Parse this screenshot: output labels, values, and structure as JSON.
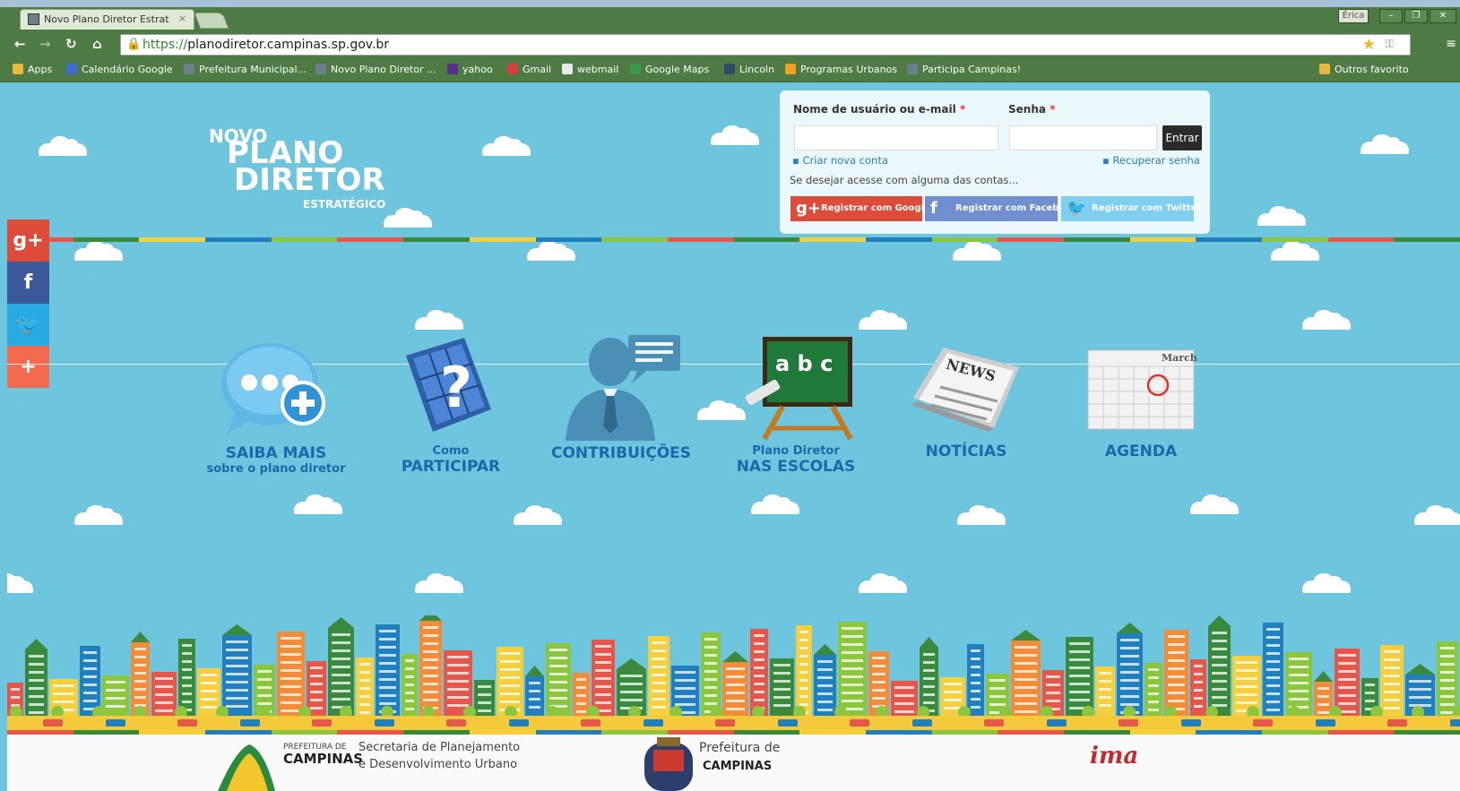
{
  "browser": {
    "tab_title": "Novo Plano Diretor Estrat",
    "tab_close": "×",
    "user_badge": "Érica",
    "url_scheme": "https://",
    "url_host": "planodiretor.campinas.sp.gov.br",
    "bookmarks": [
      {
        "label": "Apps",
        "icon": "apps-grid-icon",
        "color": "#e8b93a"
      },
      {
        "label": "Calendário Google",
        "icon": "calendar-icon",
        "color": "#3b6bd3"
      },
      {
        "label": "Prefeitura Municipal...",
        "icon": "site-favicon",
        "color": "#6b7f88"
      },
      {
        "label": "Novo Plano Diretor ...",
        "icon": "site-favicon",
        "color": "#6b7f88"
      },
      {
        "label": "yahoo",
        "icon": "yahoo-mail-icon",
        "color": "#5b2d8c"
      },
      {
        "label": "Gmail",
        "icon": "gmail-icon",
        "color": "#d43f3a"
      },
      {
        "label": "webmail",
        "icon": "webmail-icon",
        "color": "#e9e9e9"
      },
      {
        "label": "Google Maps",
        "icon": "maps-pin-icon",
        "color": "#3a9a48"
      },
      {
        "label": "Lincoln",
        "icon": "bookmark-icon",
        "color": "#2d4a6b"
      },
      {
        "label": "Programas Urbanos",
        "icon": "arrow-favicon",
        "color": "#f0a020"
      },
      {
        "label": "Participa Campinas!",
        "icon": "site-favicon",
        "color": "#6b7f88"
      }
    ],
    "other_bookmarks": "Outros favorito"
  },
  "logo": {
    "line1": "NOVO",
    "line2": "PLANO",
    "line3": "DIRETOR",
    "line4": "ESTRATÉGICO"
  },
  "login": {
    "user_label": "Nome de usuário ou e-mail",
    "password_label": "Senha",
    "required_mark": "*",
    "user_value": "",
    "password_value": "",
    "submit_label": "Entrar",
    "create_account": "Criar nova conta",
    "recover_password": "Recuperar senha",
    "social_hint": "Se desejar acesse com alguma das contas...",
    "google_label": "Registrar com Google",
    "facebook_label": "Registrar com Facebook",
    "twitter_label": "Registrar com Twitter",
    "google_color": "#dd4b39",
    "facebook_color": "#6f8fd0",
    "twitter_color": "#7fd0f0"
  },
  "share": [
    {
      "icon": "google-plus-icon",
      "glyph": "g+",
      "color": "#dd4b39"
    },
    {
      "icon": "facebook-icon",
      "glyph": "f",
      "color": "#3b5998"
    },
    {
      "icon": "twitter-icon",
      "glyph": "🐦",
      "color": "#29a9e1"
    },
    {
      "icon": "add-share-icon",
      "glyph": "+",
      "color": "#f26b50"
    }
  ],
  "menu": {
    "saiba_mais": {
      "line1": "SAIBA MAIS",
      "line2": "sobre o plano diretor"
    },
    "participar": {
      "line1": "Como",
      "line2": "PARTICIPAR"
    },
    "contribuicoes": {
      "line1": "CONTRIBUIÇÕES"
    },
    "escolas": {
      "line1": "Plano Diretor",
      "line2": "NAS ESCOLAS",
      "board_text": "a b c"
    },
    "noticias": {
      "line1": "NOTÍCIAS",
      "paper_text": "NEWS"
    },
    "agenda": {
      "line1": "AGENDA",
      "calendar_month": "March"
    }
  },
  "footer": {
    "prefeitura_small": "PREFEITURA DE",
    "campinas": "CAMPINAS",
    "secretaria": "Secretaria de Planejamento",
    "secretaria2": "e Desenvolvimento Urbano",
    "prefeitura_de": "Prefeitura de",
    "campinas2": "CAMPINAS",
    "ima": "ima"
  },
  "colors": {
    "sky": "#6ec6de",
    "stripe": [
      "#e4574a",
      "#3a8a3e",
      "#f4d03f",
      "#1f7fbf",
      "#8cc63f"
    ]
  }
}
